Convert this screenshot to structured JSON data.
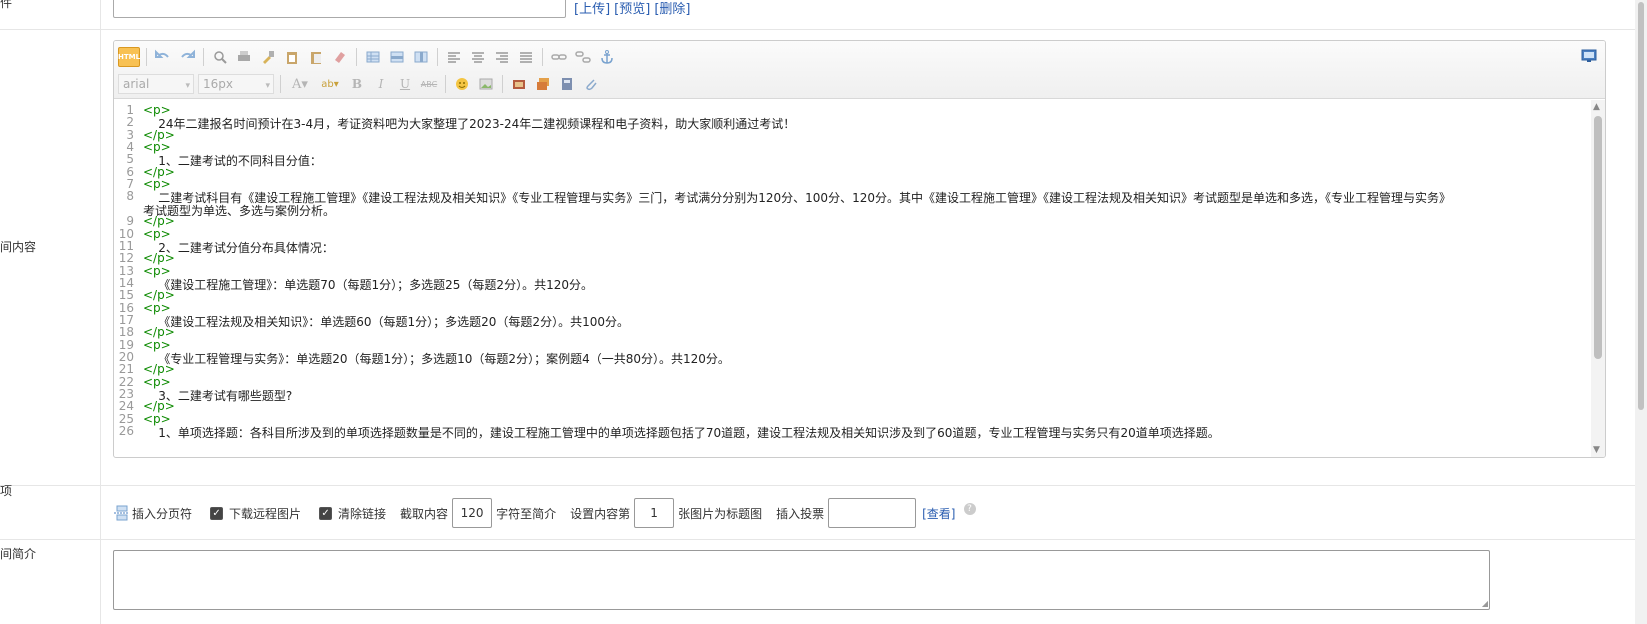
{
  "row1": {
    "label_fragment": "件",
    "links": [
      "[上传]",
      "[预览]",
      "[删除]"
    ]
  },
  "row2": {
    "label_fragment": "间内容"
  },
  "editor": {
    "font_family": "arial",
    "font_size": "16px",
    "toolbar_icons": [
      "html-icon",
      "undo-icon",
      "redo-icon",
      "find-icon",
      "print-icon",
      "format-brush-icon",
      "paste-icon",
      "paste-text-icon",
      "clear-format-icon",
      "table-icon",
      "insert-row-icon",
      "insert-column-icon",
      "align-left-icon",
      "align-center-icon",
      "align-right-icon",
      "align-justify-icon",
      "link-icon",
      "unlink-icon",
      "anchor-icon",
      "font-color-icon",
      "highlight-icon",
      "bold-icon",
      "italic-icon",
      "underline-icon",
      "strikethrough-icon",
      "emoticon-icon",
      "image-icon",
      "media-icon",
      "multi-image-icon",
      "flash-icon",
      "attachment-icon",
      "fullscreen-icon"
    ],
    "lines": [
      {
        "n": "1",
        "tag": "<p>",
        "text": ""
      },
      {
        "n": "2",
        "tag": "",
        "text": "    24年二建报名时间预计在3-4月，考证资料吧为大家整理了2023-24年二建视频课程和电子资料，助大家顺利通过考试！"
      },
      {
        "n": "3",
        "tag": "</p>",
        "text": ""
      },
      {
        "n": "4",
        "tag": "<p>",
        "text": ""
      },
      {
        "n": "5",
        "tag": "",
        "text": "    1、二建考试的不同科目分值："
      },
      {
        "n": "6",
        "tag": "</p>",
        "text": ""
      },
      {
        "n": "7",
        "tag": "<p>",
        "text": ""
      },
      {
        "n": "8",
        "tag": "",
        "text": "    二建考试科目有《建设工程施工管理》《建设工程法规及相关知识》《专业工程管理与实务》三门，考试满分分别为120分、100分、120分。其中《建设工程施工管理》《建设工程法规及相关知识》考试题型是单选和多选，《专业工程管理与实务》"
      },
      {
        "n": "",
        "tag": "",
        "text": "考试题型为单选、多选与案例分析。"
      },
      {
        "n": "9",
        "tag": "</p>",
        "text": ""
      },
      {
        "n": "10",
        "tag": "<p>",
        "text": ""
      },
      {
        "n": "11",
        "tag": "",
        "text": "    2、二建考试分值分布具体情况："
      },
      {
        "n": "12",
        "tag": "</p>",
        "text": ""
      },
      {
        "n": "13",
        "tag": "<p>",
        "text": ""
      },
      {
        "n": "14",
        "tag": "",
        "text": "    《建设工程施工管理》：单选题70（每题1分）；多选题25（每题2分）。共120分。"
      },
      {
        "n": "15",
        "tag": "</p>",
        "text": ""
      },
      {
        "n": "16",
        "tag": "<p>",
        "text": ""
      },
      {
        "n": "17",
        "tag": "",
        "text": "    《建设工程法规及相关知识》：单选题60（每题1分）；多选题20（每题2分）。共100分。"
      },
      {
        "n": "18",
        "tag": "</p>",
        "text": ""
      },
      {
        "n": "19",
        "tag": "<p>",
        "text": ""
      },
      {
        "n": "20",
        "tag": "",
        "text": "    《专业工程管理与实务》：单选题20（每题1分）；多选题10（每题2分）；案例题4（一共80分）。共120分。"
      },
      {
        "n": "21",
        "tag": "</p>",
        "text": ""
      },
      {
        "n": "22",
        "tag": "<p>",
        "text": ""
      },
      {
        "n": "23",
        "tag": "",
        "text": "    3、二建考试有哪些题型?"
      },
      {
        "n": "24",
        "tag": "</p>",
        "text": ""
      },
      {
        "n": "25",
        "tag": "<p>",
        "text": ""
      },
      {
        "n": "26",
        "tag": "",
        "text": "    1、单项选择题：各科目所涉及到的单项选择题数量是不同的，建设工程施工管理中的单项选择题包括了70道题，建设工程法规及相关知识涉及到了60道题，专业工程管理与实务只有20道单项选择题。"
      }
    ]
  },
  "row3": {
    "label_fragment": "项",
    "insert_page_break": "插入分页符",
    "download_remote_images": "下载远程图片",
    "clear_links": "清除链接",
    "extract_prefix": "截取内容",
    "extract_value": "120",
    "extract_suffix": "字符至简介",
    "title_image_prefix": "设置内容第",
    "title_image_value": "1",
    "title_image_suffix": "张图片为标题图",
    "insert_vote": "插入投票",
    "view_link": "[查看]",
    "checkbox_checked": true
  },
  "row4": {
    "label_fragment": "间简介"
  }
}
